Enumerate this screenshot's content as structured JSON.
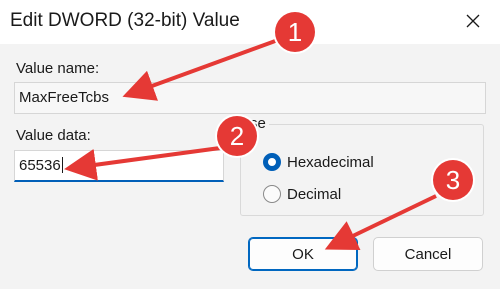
{
  "window": {
    "title": "Edit DWORD (32-bit) Value"
  },
  "fields": {
    "value_name": {
      "label": "Value name:",
      "value": "MaxFreeTcbs"
    },
    "value_data": {
      "label": "Value data:",
      "value": "65536"
    }
  },
  "base": {
    "title_partial": "se",
    "options": [
      {
        "label": "Hexadecimal",
        "checked": true
      },
      {
        "label": "Decimal",
        "checked": false
      }
    ]
  },
  "buttons": {
    "ok": "OK",
    "cancel": "Cancel"
  },
  "annotations": {
    "badges": [
      "1",
      "2",
      "3"
    ],
    "color": "#e53935"
  },
  "colors": {
    "accent": "#005fb8",
    "dialog_bg": "#f3f3f3",
    "titlebar_bg": "#ffffff"
  }
}
